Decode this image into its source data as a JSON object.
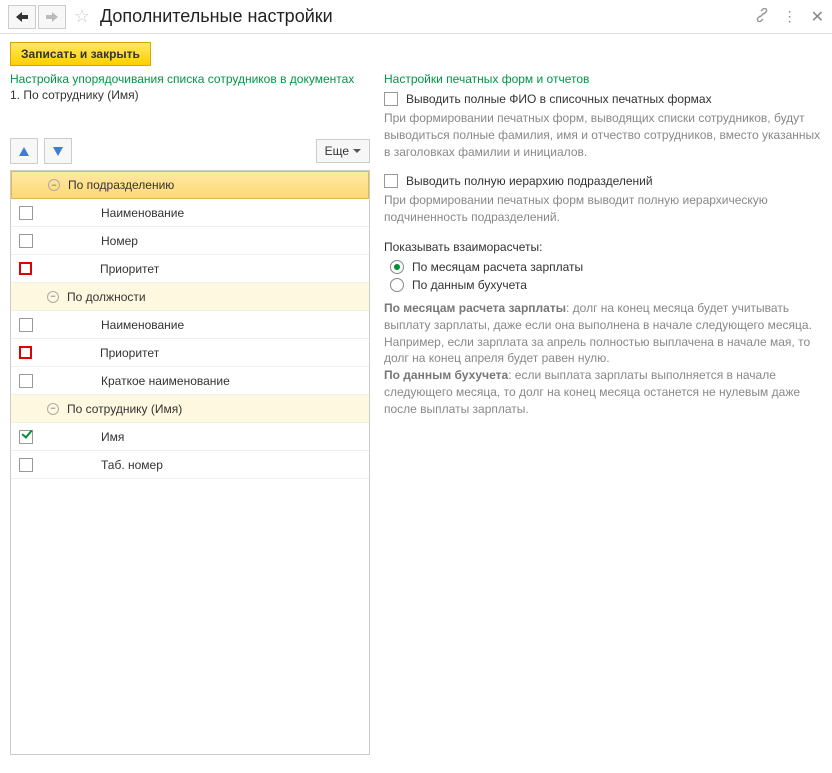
{
  "titlebar": {
    "title": "Дополнительные настройки"
  },
  "toolbar": {
    "save_close": "Записать и закрыть",
    "more": "Еще"
  },
  "left": {
    "heading": "Настройка упорядочивания списка сотрудников в документах",
    "order_summary": "1. По сотруднику (Имя)",
    "tree": {
      "g1": {
        "label": "По подразделению"
      },
      "g1_i1": "Наименование",
      "g1_i2": "Номер",
      "g1_i3": "Приоритет",
      "g2": {
        "label": "По должности"
      },
      "g2_i1": "Наименование",
      "g2_i2": "Приоритет",
      "g2_i3": "Краткое наименование",
      "g3": {
        "label": "По сотруднику (Имя)"
      },
      "g3_i1": "Имя",
      "g3_i2": "Таб. номер"
    }
  },
  "right": {
    "heading": "Настройки печатных форм и отчетов",
    "opt_full_fio": "Выводить полные ФИО в списочных печатных формах",
    "opt_full_fio_desc": "При формировании печатных форм, выводящих списки сотрудников, будут выводиться полные фамилия, имя и отчество сотрудников, вместо указанных в заголовках фамилии и инициалов.",
    "opt_full_hier": "Выводить полную иерархию подразделений",
    "opt_full_hier_desc": "При формировании печатных форм выводит полную иерархическую подчиненность подразделений.",
    "mutual_label": "Показывать взаиморасчеты:",
    "radio1": "По месяцам расчета зарплаты",
    "radio2": "По данным бухучета",
    "explain_b1": "По месяцам расчета зарплаты",
    "explain_t1": ": долг на конец месяца будет учитывать выплату зарплаты, даже если она выполнена в начале следующего месяца. Например, если зарплата за апрель полностью выплачена в начале мая, то долг на конец апреля будет равен нулю.",
    "explain_b2": "По данным бухучета",
    "explain_t2": ": если выплата зарплаты выполняется в начале следующего месяца, то долг на конец месяца останется не нулевым даже после выплаты зарплаты."
  }
}
